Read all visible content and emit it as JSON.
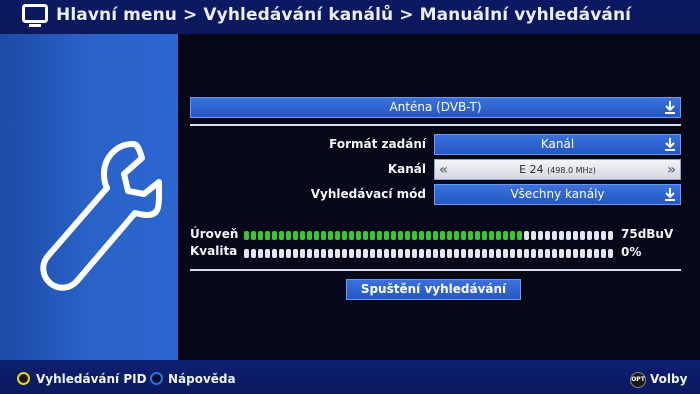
{
  "header": {
    "breadcrumb": "Hlavní menu > Vyhledávání kanálů > Manuální vyhledávání"
  },
  "main": {
    "antenna_select": "Anténa (DVB-T)",
    "input_format": {
      "label": "Formát zadání",
      "value": "Kanál"
    },
    "channel": {
      "label": "Kanál",
      "value": "E 24",
      "frequency": "(498.0 MHz)"
    },
    "search_mode": {
      "label": "Vyhledávací mód",
      "value": "Všechny kanály"
    },
    "level": {
      "label": "Úroveň",
      "value": "75dBuV",
      "fraction": 0.75
    },
    "quality": {
      "label": "Kvalita",
      "value": "0%",
      "fraction": 0.0
    },
    "start_button": "Spuštění vyhledávání"
  },
  "footer": {
    "yellow_action": "Vyhledávání PID",
    "blue_action": "Nápověda",
    "opt_badge": "OPT",
    "options": "Volby"
  },
  "colors": {
    "accent_blue": "#2c66cf",
    "meter_green": "#37c92f",
    "yellow_key": "#e6d21a",
    "blue_key": "#2f6fe0"
  }
}
